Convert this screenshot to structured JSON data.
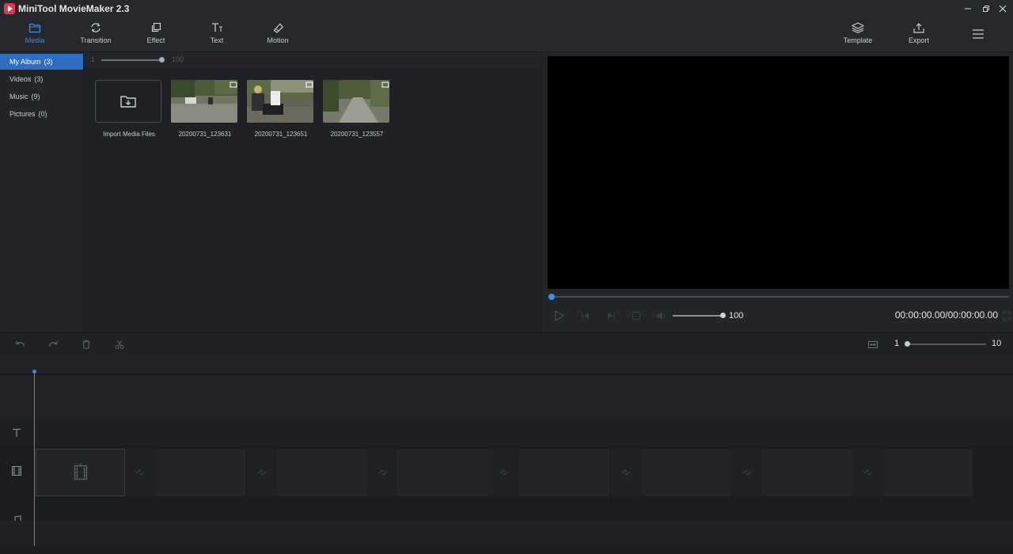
{
  "app": {
    "title": "MiniTool MovieMaker 2.3"
  },
  "toolbar": {
    "items": [
      {
        "label": "Media",
        "icon": "folder-icon"
      },
      {
        "label": "Transition",
        "icon": "transition-icon"
      },
      {
        "label": "Effect",
        "icon": "effect-icon"
      },
      {
        "label": "Text",
        "icon": "text-icon"
      },
      {
        "label": "Motion",
        "icon": "motion-icon"
      }
    ],
    "template_label": "Template",
    "export_label": "Export"
  },
  "sidebar": {
    "items": [
      {
        "label": "My Album",
        "count": "(3)"
      },
      {
        "label": "Videos",
        "count": "(3)"
      },
      {
        "label": "Music",
        "count": "(9)"
      },
      {
        "label": "Pictures",
        "count": "(0)"
      }
    ]
  },
  "media": {
    "zoom_min": "1",
    "zoom_max": "100",
    "import_label": "Import Media Files",
    "files": [
      {
        "name": "20200731_123631"
      },
      {
        "name": "20200731_123651"
      },
      {
        "name": "20200731_123557"
      }
    ]
  },
  "preview": {
    "volume": "100",
    "time": "00:00:00.00/00:00:00.00"
  },
  "timeline": {
    "zoom_min": "1",
    "zoom_max": "10"
  },
  "colors": {
    "accent": "#3f8ee6",
    "brand": "#e8354b"
  }
}
